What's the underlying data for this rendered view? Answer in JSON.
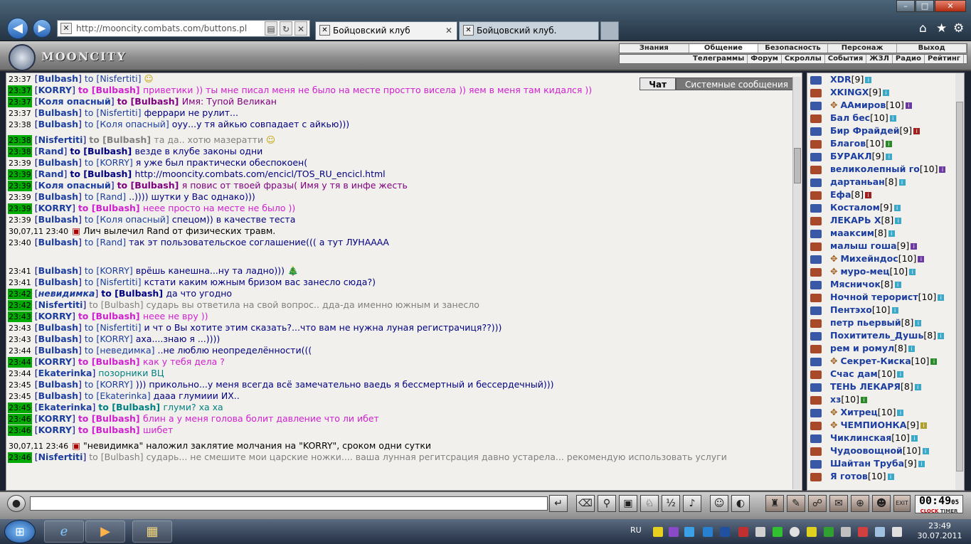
{
  "browser": {
    "address": "http://mooncity.combats.com/buttons.pl",
    "tabs": [
      "Бойцовский клуб",
      "Бойцовский клуб."
    ],
    "window_controls": [
      "–",
      "□",
      "✕"
    ]
  },
  "header": {
    "brand": "MOONCITY",
    "top_menu": [
      {
        "label": "Знания"
      },
      {
        "label": "Общение",
        "active": true
      },
      {
        "label": "Безопасность"
      },
      {
        "label": "Персонаж"
      },
      {
        "label": "Выход"
      }
    ],
    "sub_menu": [
      "Телеграммы",
      "Форум",
      "Скроллы",
      "События",
      "ЖЗЛ",
      "Радио",
      "Рейтинг"
    ]
  },
  "chat": {
    "tabs": {
      "chat": "Чат",
      "system": "Системные сообщения"
    },
    "messages": [
      {
        "time": "23:37",
        "hl": false,
        "from": "Bulbash",
        "to": "Nisfertiti",
        "to_bold": false,
        "text": "",
        "color": "#1b3ea0",
        "smile": "stick"
      },
      {
        "time": "23:37",
        "hl": true,
        "from": "KORRY",
        "to": "Bulbash",
        "to_bold": true,
        "text": "приветики )) ты мне писал меня не было на месте простто висела )) яем в меня там кидался ))",
        "color": "#d020d0"
      },
      {
        "time": "23:37",
        "hl": true,
        "from": "Коля опасный",
        "to": "Bulbash",
        "to_bold": true,
        "text": "Имя: Тупой Великан",
        "color": "#800080"
      },
      {
        "time": "23:37",
        "hl": false,
        "from": "Bulbash",
        "to": "Nisfertiti",
        "to_bold": false,
        "text": "феррари не рулит...",
        "color": "#000080"
      },
      {
        "time": "23:38",
        "hl": false,
        "from": "Bulbash",
        "to": "Коля опасный",
        "to_bold": false,
        "text": "оуу...у тя айкью совпадает с айкью)))",
        "color": "#000080"
      },
      {
        "time": "23:38",
        "hl": true,
        "from": "Nisfertiti",
        "to": "Bulbash",
        "to_bold": true,
        "text": "та да.. хотю мазератти",
        "color": "#808080",
        "grey_to": true,
        "smile": "wings",
        "tall": true
      },
      {
        "time": "23:38",
        "hl": true,
        "from": "Rand",
        "to": "Bulbash",
        "to_bold": true,
        "text": "везде в клубе законы одни",
        "color": "#000080"
      },
      {
        "time": "23:39",
        "hl": false,
        "from": "Bulbash",
        "to": "KORRY",
        "to_bold": false,
        "text": "я уже был практически обеспокоен(",
        "color": "#000080"
      },
      {
        "time": "23:39",
        "hl": true,
        "from": "Rand",
        "to": "Bulbash",
        "to_bold": true,
        "text": "http://mooncity.combats.com/encicl/TOS_RU_encicl.html",
        "color": "#000080"
      },
      {
        "time": "23:39",
        "hl": true,
        "from": "Коля опасный",
        "to": "Bulbash",
        "to_bold": true,
        "text": "я повис от твоей фразы( Имя у тя в инфе жесть",
        "color": "#800080"
      },
      {
        "time": "23:39",
        "hl": false,
        "from": "Bulbash",
        "to": "Rand",
        "to_bold": false,
        "text": "..)))) шутки у Вас однако)))",
        "color": "#000080"
      },
      {
        "time": "23:39",
        "hl": true,
        "from": "KORRY",
        "to": "Bulbash",
        "to_bold": true,
        "text": "неее просто на месте не было ))",
        "color": "#d020d0"
      },
      {
        "time": "23:39",
        "hl": false,
        "from": "Bulbash",
        "to": "Коля опасный",
        "to_bold": false,
        "text": "спецом)) в качестве теста",
        "color": "#000080"
      },
      {
        "time": "30,07,11 23:40",
        "hl": false,
        "sys": true,
        "text": "Лич вылечил Rand от физических травм."
      },
      {
        "time": "23:40",
        "hl": false,
        "from": "Bulbash",
        "to": "Rand",
        "to_bold": false,
        "text": "так эт пользовательское соглашение((( а тут ЛУНАААА",
        "color": "#000080"
      },
      {
        "time": "23:41",
        "hl": false,
        "from": "Bulbash",
        "to": "KORRY",
        "to_bold": false,
        "text": "врёшь канешна...ну та ладно)))",
        "color": "#000080",
        "smile": "tree",
        "big": true
      },
      {
        "time": "23:41",
        "hl": false,
        "from": "Bulbash",
        "to": "Nisfertiti",
        "to_bold": false,
        "text": "кстати каким южным бризом вас занесло сюда?)",
        "color": "#000080"
      },
      {
        "time": "23:42",
        "hl": true,
        "from": "невидимка",
        "italic": true,
        "to": "Bulbash",
        "to_bold": true,
        "text": "да что угодно",
        "color": "#000080"
      },
      {
        "time": "23:42",
        "hl": true,
        "from": "Nisfertiti",
        "to": "Bulbash",
        "to_bold": false,
        "text": "сударь вы ответила на свой вопрос.. дда-да именно южным и занесло",
        "color": "#808080",
        "grey_to": true
      },
      {
        "time": "23:43",
        "hl": true,
        "from": "KORRY",
        "to": "Bulbash",
        "to_bold": true,
        "text": "неее не вру ))",
        "color": "#d020d0"
      },
      {
        "time": "23:43",
        "hl": false,
        "from": "Bulbash",
        "to": "Nisfertiti",
        "to_bold": false,
        "text": "и чт о Вы хотите этим сказать?...что вам не нужна луная регистрачиця??)))",
        "color": "#000080"
      },
      {
        "time": "23:43",
        "hl": false,
        "from": "Bulbash",
        "to": "KORRY",
        "to_bold": false,
        "text": "аха....знаю я ...))))",
        "color": "#000080"
      },
      {
        "time": "23:44",
        "hl": false,
        "from": "Bulbash",
        "to": "неведимка",
        "to_bold": false,
        "text": "..не люблю неопределённости(((",
        "color": "#000080"
      },
      {
        "time": "23:44",
        "hl": true,
        "from": "KORRY",
        "to": "Bulbash",
        "to_bold": true,
        "text": "как у тебя дела ?",
        "color": "#d020d0"
      },
      {
        "time": "23:44",
        "hl": false,
        "from": "Ekaterinka",
        "to": "",
        "to_bold": false,
        "text": "позорники ВЦ",
        "color": "#008080",
        "no_to": true
      },
      {
        "time": "23:45",
        "hl": false,
        "from": "Bulbash",
        "to": "KORRY",
        "to_bold": false,
        "text": "))) прикольно...у меня всегда всё замечательно ваедь я бессмертный и бессердечный)))",
        "color": "#000080"
      },
      {
        "time": "23:45",
        "hl": false,
        "from": "Bulbash",
        "to": "Ekaterinka",
        "to_bold": false,
        "text": "дааа глумиии ИХ..",
        "color": "#000080"
      },
      {
        "time": "23:45",
        "hl": true,
        "from": "Ekaterinka",
        "to": "Bulbash",
        "to_bold": true,
        "text": "глуми? ха ха",
        "color": "#008080",
        "teal_to": true
      },
      {
        "time": "23:46",
        "hl": true,
        "from": "KORRY",
        "to": "Bulbash",
        "to_bold": true,
        "text": "блин а у меня голова болит давление что ли ибет",
        "color": "#d020d0"
      },
      {
        "time": "23:46",
        "hl": true,
        "from": "KORRY",
        "to": "Bulbash",
        "to_bold": true,
        "text": "шибет",
        "color": "#d020d0"
      },
      {
        "time": "30,07,11 23:46",
        "hl": false,
        "sys": true,
        "tall": true,
        "text": "\"невидимка\" наложил заклятие молчания на \"KORRY\", сроком одни сутки"
      },
      {
        "time": "23:46",
        "hl": true,
        "from": "Nisfertiti",
        "to": "Bulbash",
        "to_bold": false,
        "text": "сударь... не смешите мои царские ножки.... ваша лунная регитсрация давно устарела... рекомендую использовать услуги",
        "color": "#808080",
        "grey_to": true
      }
    ]
  },
  "users": [
    {
      "name": "XDR",
      "level": "[9]",
      "info": "b"
    },
    {
      "name": "XKINGX",
      "level": "[9]",
      "info": "b"
    },
    {
      "name": "ААмиров",
      "level": "[10]",
      "info": "p",
      "emblem": true
    },
    {
      "name": "Бал бес",
      "level": "[10]",
      "info": "b"
    },
    {
      "name": "Бир Фрайдей",
      "level": "[9]",
      "info": "r"
    },
    {
      "name": "Благов",
      "level": "[10]",
      "info": "gr"
    },
    {
      "name": "БУРАКЛ",
      "level": "[9]",
      "info": "b"
    },
    {
      "name": "великолепный го",
      "level": "[10]",
      "info": "p"
    },
    {
      "name": "дартаньан",
      "level": "[8]",
      "info": "b"
    },
    {
      "name": "Ефа",
      "level": "[8]",
      "info": "r"
    },
    {
      "name": "Косталом",
      "level": "[9]",
      "info": "b"
    },
    {
      "name": "ЛЕКАРЬ Х",
      "level": "[8]",
      "info": "b"
    },
    {
      "name": "мааксим",
      "level": "[8]",
      "info": "b"
    },
    {
      "name": "малыш гоша",
      "level": "[9]",
      "info": "p"
    },
    {
      "name": "Михейндос",
      "level": "[10]",
      "info": "p",
      "emblem": true
    },
    {
      "name": "муро-мец",
      "level": "[10]",
      "info": "b",
      "emblem": true
    },
    {
      "name": "Мясничок",
      "level": "[8]",
      "info": "b"
    },
    {
      "name": "Ночной терорист",
      "level": "[10]",
      "info": "b"
    },
    {
      "name": "Пентэхо",
      "level": "[10]",
      "info": "b"
    },
    {
      "name": "петр пьервый",
      "level": "[8]",
      "info": "b"
    },
    {
      "name": "Похититель_Душь",
      "level": "[8]",
      "info": "b"
    },
    {
      "name": "рем и ромул",
      "level": "[8]",
      "info": "b"
    },
    {
      "name": "Секрет-Киска",
      "level": "[10]",
      "info": "gr",
      "emblem": true
    },
    {
      "name": "Счас дам",
      "level": "[10]",
      "info": "b"
    },
    {
      "name": "ТЕНЬ ЛЕКАРЯ",
      "level": "[8]",
      "info": "b"
    },
    {
      "name": "хз",
      "level": "[10]",
      "info": "gr"
    },
    {
      "name": "Хитрец",
      "level": "[10]",
      "info": "b",
      "emblem": true
    },
    {
      "name": "ЧЕМПИОНКА",
      "level": "[9]",
      "info": "y",
      "emblem": true
    },
    {
      "name": "Чиклинская",
      "level": "[10]",
      "info": "b"
    },
    {
      "name": "Чудоовощной",
      "level": "[10]",
      "info": "b"
    },
    {
      "name": "Шайтан Труба",
      "level": "[9]",
      "info": "b"
    },
    {
      "name": "Я готов",
      "level": "[10]",
      "info": "b"
    }
  ],
  "bottom": {
    "input_value": "",
    "clock": {
      "time": "00:49",
      "sec": "05",
      "labels": [
        "CLOCK",
        "TIMER"
      ]
    }
  },
  "taskbar": {
    "lang": "RU",
    "time": "23:49",
    "date": "30.07.2011"
  }
}
